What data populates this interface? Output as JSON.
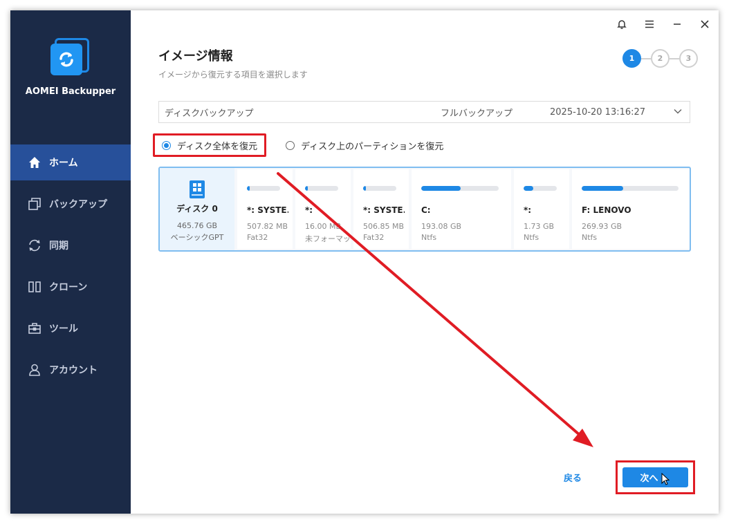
{
  "app": {
    "name": "AOMEI Backupper"
  },
  "nav": {
    "items": [
      {
        "label": "ホーム",
        "icon": "home-icon"
      },
      {
        "label": "バックアップ",
        "icon": "backup-icon"
      },
      {
        "label": "同期",
        "icon": "sync-icon"
      },
      {
        "label": "クローン",
        "icon": "clone-icon"
      },
      {
        "label": "ツール",
        "icon": "tools-icon"
      },
      {
        "label": "アカウント",
        "icon": "account-icon"
      }
    ],
    "active": 0
  },
  "page": {
    "title": "イメージ情報",
    "subtitle": "イメージから復元する項目を選択します"
  },
  "steps": {
    "items": [
      "1",
      "2",
      "3"
    ],
    "current": 1
  },
  "image_select": {
    "name": "ディスクバックアップ",
    "type": "フルバックアップ",
    "time": "2025-10-20 13:16:27"
  },
  "restore_options": {
    "whole_disk": "ディスク全体を復元",
    "partitions": "ディスク上のパーティションを復元",
    "selected": "whole_disk"
  },
  "disk": {
    "name": "ディスク 0",
    "size": "465.76 GB",
    "kind": "ベーシックGPT"
  },
  "partitions": [
    {
      "name": "*: SYSTE...",
      "size": "507.82 MB",
      "fs": "Fat32",
      "used": 0.06
    },
    {
      "name": "*:",
      "size": "16.00 MB",
      "fs": "未フォーマット",
      "used": 0.06
    },
    {
      "name": "*: SYSTE...",
      "size": "506.85 MB",
      "fs": "Fat32",
      "used": 0.06
    },
    {
      "name": "C:",
      "size": "193.08 GB",
      "fs": "Ntfs",
      "used": 0.51
    },
    {
      "name": "*:",
      "size": "1.73 GB",
      "fs": "Ntfs",
      "used": 0.3
    },
    {
      "name": "F: LENOVO",
      "size": "269.93 GB",
      "fs": "Ntfs",
      "used": 0.43
    }
  ],
  "footer": {
    "back": "戻る",
    "next": "次へ"
  },
  "colors": {
    "accent": "#1e88e5",
    "sidebar": "#1b2a47",
    "nav_active": "#27509a",
    "annotation": "#e01c24"
  }
}
